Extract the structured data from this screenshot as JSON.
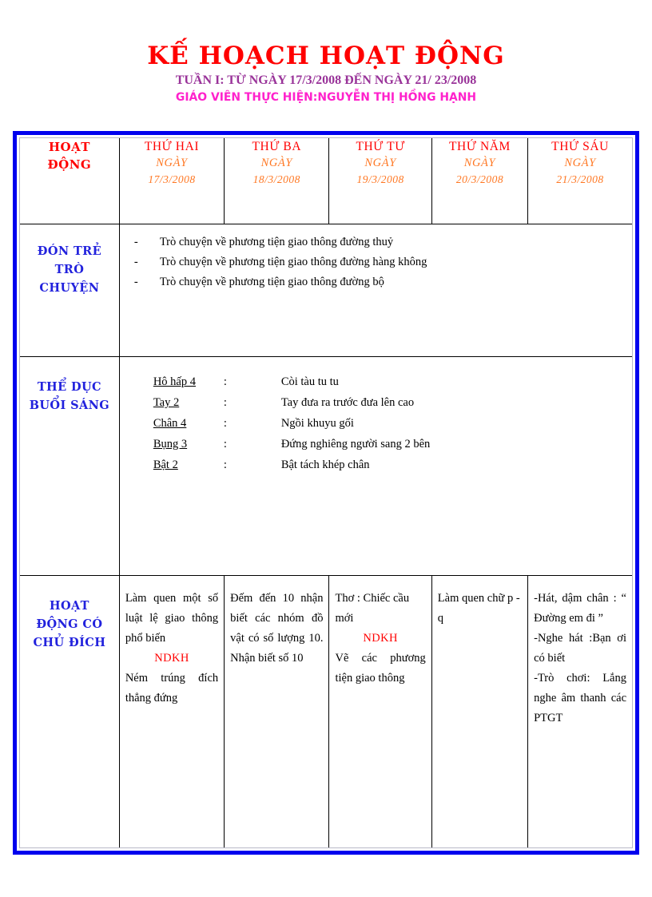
{
  "title": {
    "main": "KẾ HOẠCH HOẠT ĐỘNG",
    "week_line": "TUẦN I: TỪ NGÀY 17/3/2008 ĐẾN NGÀY 21/ 23/2008",
    "teacher_line": "GIÁO VIÊN THỰC HIỆN:NGUYỄN THỊ HỒNG HẠNH"
  },
  "colors": {
    "title_red": "#ff0000",
    "subtitle_purple": "#993399",
    "teacher_magenta": "#ff22cc",
    "label_blue": "#2222dd",
    "date_orange": "#ff7722",
    "frame_blue": "#0000ee"
  },
  "table": {
    "header": {
      "activity": {
        "line1": "HOẠT",
        "line2": "ĐỘNG"
      },
      "days": [
        {
          "name": "THỨ HAI",
          "ngay": "NGÀY",
          "date": "17/3/2008"
        },
        {
          "name": "THỨ BA",
          "ngay": "NGÀY",
          "date": "18/3/2008"
        },
        {
          "name": "THỨ TƯ",
          "ngay": "NGÀY",
          "date": "19/3/2008"
        },
        {
          "name": "THỨ NĂM",
          "ngay": "NGÀY",
          "date": "20/3/2008"
        },
        {
          "name": "THỨ SÁU",
          "ngay": "NGÀY",
          "date": "21/3/2008"
        }
      ]
    },
    "rows": {
      "welcome": {
        "label_line1": "ĐÓN TRẺ",
        "label_line2": "TRÒ",
        "label_line3": "CHUYỆN",
        "bullet": "-",
        "items": [
          "Trò chuyện về phương tiện giao thông đường thuỷ",
          "Trò chuyện về phương tiện giao thông đường hàng không",
          "Trò chuyện về phương tiện giao thông đường bộ"
        ]
      },
      "exercise": {
        "label_line1": "THỂ DỤC",
        "label_line2": "BUỔI SÁNG",
        "colon": ":",
        "items": [
          {
            "name": "Hô hấp 4",
            "desc": "Còi tàu tu tu"
          },
          {
            "name": "Tay 2",
            "desc": "Tay đưa ra trước đưa lên cao"
          },
          {
            "name": "Chân 4",
            "desc": "Ngồi khuyu gối"
          },
          {
            "name": "Bụng 3",
            "desc": "Đứng nghiêng người sang 2 bên"
          },
          {
            "name": "Bật 2",
            "desc": "Bật tách khép chân"
          }
        ]
      },
      "purposeful": {
        "label_line1": "HOẠT",
        "label_line2": "ĐỘNG CÓ",
        "label_line3": "CHỦ ĐÍCH",
        "monday": {
          "before": "Làm quen một số luật lệ giao thông phổ biến",
          "ndkh": "NDKH",
          "after": "Ném trúng đích thẳng đứng"
        },
        "tuesday": {
          "before": "Đếm đến 10 nhận biết các nhóm đồ vật có số lượng 10. Nhận biết số 10",
          "ndkh": "",
          "after": ""
        },
        "wednesday": {
          "before": "Thơ : Chiếc cầu mới",
          "ndkh": "NDKH",
          "after": "Vẽ các phương tiện giao thông"
        },
        "thursday": {
          "before": "Làm quen chữ p - q",
          "ndkh": "",
          "after": ""
        },
        "friday": {
          "line1": "-Hát, dậm chân : “ Đường em đi ”",
          "line2": "-Nghe hát :Bạn ơi có biết",
          "line3": "-Trò chơi: Lắng nghe âm thanh các PTGT"
        }
      }
    }
  }
}
